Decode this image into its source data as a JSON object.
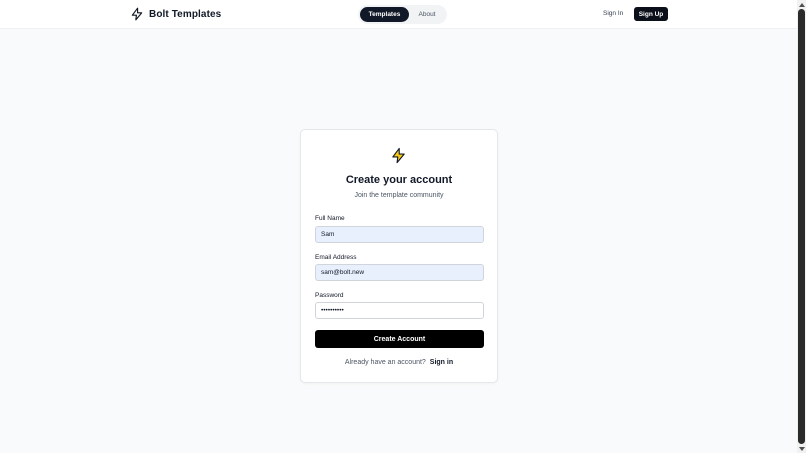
{
  "header": {
    "brand": "Bolt Templates",
    "nav": [
      {
        "label": "Templates",
        "active": true
      },
      {
        "label": "About",
        "active": false
      }
    ],
    "signin_label": "Sign In",
    "signup_label": "Sign Up"
  },
  "card": {
    "icon": "bolt-icon",
    "title": "Create your account",
    "subtitle": "Join the template community",
    "fields": {
      "name": {
        "label": "Full Name",
        "value": "Sam"
      },
      "email": {
        "label": "Email Address",
        "value": "sam@bolt.new"
      },
      "password": {
        "label": "Password",
        "value": "••••••••••"
      }
    },
    "submit_label": "Create Account",
    "footer_text": "Already have an account?",
    "footer_link": "Sign in"
  },
  "colors": {
    "accent": "#111827",
    "bolt_fill": "#facc15",
    "autofill_bg": "#e8f0fe"
  }
}
